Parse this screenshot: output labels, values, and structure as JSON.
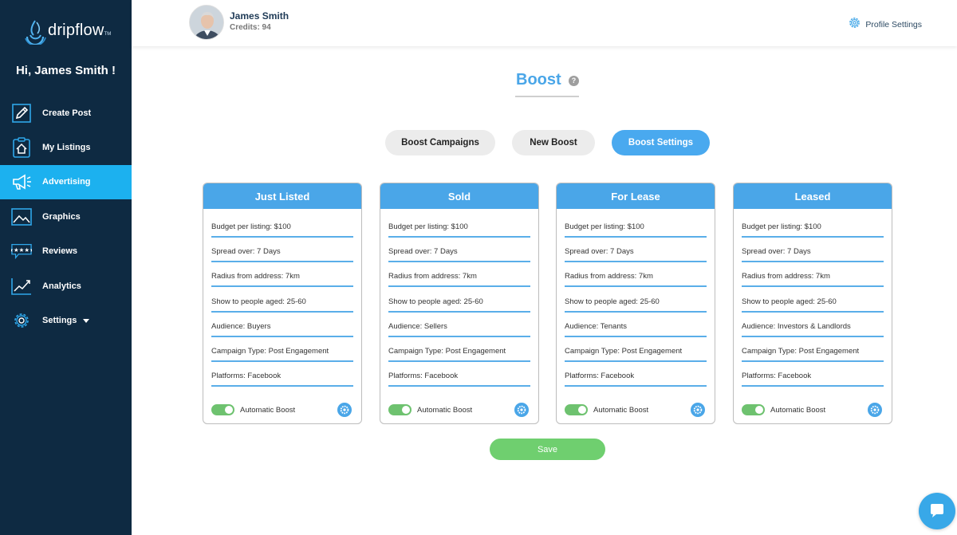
{
  "brand": {
    "name": "dripflow",
    "tm": "TM"
  },
  "sidebar": {
    "greeting": "Hi, James Smith !",
    "items": [
      {
        "label": "Create Post",
        "icon": "pencil-icon"
      },
      {
        "label": "My Listings",
        "icon": "house-clipboard-icon"
      },
      {
        "label": "Advertising",
        "icon": "megaphone-icon",
        "active": true
      },
      {
        "label": "Graphics",
        "icon": "image-icon"
      },
      {
        "label": "Reviews",
        "icon": "review-stars-icon"
      },
      {
        "label": "Analytics",
        "icon": "line-chart-icon"
      },
      {
        "label": "Settings",
        "icon": "gear-icon",
        "dropdown": true
      }
    ]
  },
  "header": {
    "user_name": "James Smith",
    "credits": "Credits: 94",
    "profile_settings": "Profile Settings"
  },
  "main": {
    "title": "Boost",
    "help": "?",
    "tabs": [
      "Boost Campaigns",
      "New Boost",
      "Boost Settings"
    ],
    "active_tab": "Boost Settings",
    "cards": [
      {
        "title": "Just Listed",
        "rows": [
          "Budget per listing: $100",
          "Spread over: 7 Days",
          "Radius from address: 7km",
          "Show to people aged: 25-60",
          "Audience: Buyers",
          "Campaign Type: Post Engagement",
          "Platforms: Facebook"
        ],
        "toggle_label": "Automatic Boost",
        "toggle_on": true
      },
      {
        "title": "Sold",
        "rows": [
          "Budget per listing: $100",
          "Spread over: 7 Days",
          "Radius from address: 7km",
          "Show to people aged: 25-60",
          "Audience: Sellers",
          "Campaign Type: Post Engagement",
          "Platforms: Facebook"
        ],
        "toggle_label": "Automatic Boost",
        "toggle_on": true
      },
      {
        "title": "For Lease",
        "rows": [
          "Budget per listing: $100",
          "Spread over: 7 Days",
          "Radius from address: 7km",
          "Show to people aged: 25-60",
          "Audience: Tenants",
          "Campaign Type: Post Engagement",
          "Platforms: Facebook"
        ],
        "toggle_label": "Automatic Boost",
        "toggle_on": true
      },
      {
        "title": "Leased",
        "rows": [
          "Budget per listing: $100",
          "Spread over: 7 Days",
          "Radius from address: 7km",
          "Show to people aged: 25-60",
          "Audience: Investors & Landlords",
          "Campaign Type: Post Engagement",
          "Platforms: Facebook"
        ],
        "toggle_label": "Automatic Boost",
        "toggle_on": true
      }
    ],
    "save_label": "Save"
  },
  "colors": {
    "sidebar_bg": "#0e2a42",
    "accent_blue": "#4aa6e8",
    "active_nav": "#1cb1ef",
    "toggle_green": "#6ec26f",
    "save_green": "#6fcf6f"
  }
}
